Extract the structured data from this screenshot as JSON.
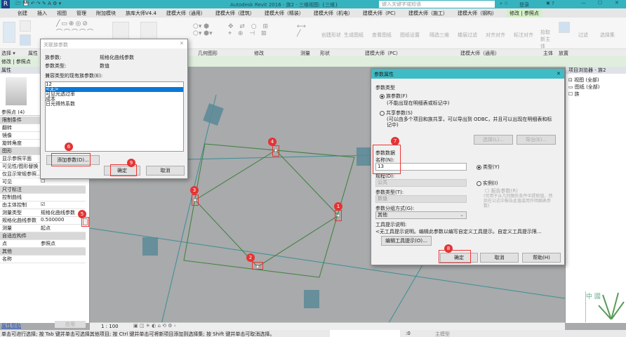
{
  "titlebar": {
    "title": "Autodesk Revit 2016 -  族2 - 三维视图: {三维}",
    "search_placeholder": "键入关键字或短语",
    "login": "登录"
  },
  "tabs": [
    "创建",
    "插入",
    "视图",
    "管理",
    "附加模块",
    "族库大师V4.4",
    "建模大师（通用）",
    "建模大师（建筑）",
    "建模大师（精装）",
    "建模大师（机电）",
    "建模大师（PC）",
    "建模大师（施工）",
    "建模大师（钢构）",
    "修改 | 参照点"
  ],
  "ribbon_panels": [
    "选择 ▾",
    "属性",
    "几何图形",
    "修改",
    "测量",
    "形状",
    "建模大师（PC）",
    "建模大师（通用）",
    "主体",
    "放置"
  ],
  "ribbon_buttons": [
    "创建形状",
    "生成图纸",
    "查看图纸",
    "图纸设置",
    "隔选三维",
    "楼层过滤",
    "对齐对齐",
    "标注对齐",
    "拾取新主体",
    "过滤",
    "选择集"
  ],
  "context_label": "修改 | 参照点",
  "properties": {
    "header": "属性",
    "type_selector": "参照点 (4)",
    "rows": [
      {
        "k": "限制条件",
        "v": "",
        "head": true
      },
      {
        "k": "翻转",
        "v": ""
      },
      {
        "k": "镜像",
        "v": ""
      },
      {
        "k": "旋转角度",
        "v": ""
      },
      {
        "k": "图形",
        "v": "",
        "head": true
      },
      {
        "k": "显示参照平面",
        "v": ""
      },
      {
        "k": "可见性/图形替换",
        "v": ""
      },
      {
        "k": "仅显示常规参照...",
        "v": ""
      },
      {
        "k": "可见",
        "v": "☐"
      },
      {
        "k": "尺寸标注",
        "v": "",
        "head": true
      },
      {
        "k": "控制曲线",
        "v": ""
      },
      {
        "k": "由主体控制",
        "v": "☑"
      },
      {
        "k": "测量类型",
        "v": "规格化曲线参数"
      },
      {
        "k": "规格化曲线参数",
        "v": "0.500000"
      },
      {
        "k": "测量",
        "v": "起点"
      },
      {
        "k": "自适应构件",
        "v": "",
        "head": true
      },
      {
        "k": "点",
        "v": "参照点"
      },
      {
        "k": "其他",
        "v": "",
        "head": true
      },
      {
        "k": "名称",
        "v": ""
      }
    ],
    "help_link": "属性帮助",
    "apply": "应用"
  },
  "dialog_assoc": {
    "title": "关联族参数",
    "family_param_label": "族参数:",
    "family_param_value": "规格化曲线参数",
    "param_type_label": "参数类型:",
    "param_type_value": "数值",
    "list_label": "兼容类型的现有族参数(E):",
    "list": [
      "12",
      "<无>",
      "可见光透过率",
      "成本",
      "日光得热系数"
    ],
    "selected": 1,
    "add_param": "添加参数(D)...",
    "ok": "确定",
    "cancel": "取消"
  },
  "dialog_param": {
    "title": "参数属性",
    "section_type": "参数类型",
    "family_param": "族参数(F)",
    "family_param_note": "(不能出现在明细表或标记中)",
    "shared_param": "共享参数(S)",
    "shared_param_note": "(可以由多个项目和族共享，可以导出到 ODBC，并且可以出现在明细表和标记中)",
    "select_btn": "选择(L)...",
    "export_btn": "导出(E)...",
    "section_data": "参数数据",
    "name_label": "名称(N):",
    "name_value": "13",
    "type_radio": "类型(Y)",
    "instance_radio": "实例(I)",
    "discipline_label": "规程(D):",
    "discipline_value": "公共",
    "ptype_label": "参数类型(T):",
    "ptype_value": "数值",
    "group_label": "参数分组方式(G):",
    "group_value": "其他",
    "report_param": "报告参数(R)",
    "report_note": "(可用于从几何图形条件中提取值，然后在公式中报告此值或用作明细表参数)",
    "tooltip_label": "工具提示说明:",
    "tooltip_value": "<无工具提示说明。编辑此参数以编写自定义工具提示。自定义工具提示限...",
    "edit_tooltip": "编辑工具提示(O)...",
    "ok": "确定",
    "cancel": "取消",
    "help": "帮助(H)"
  },
  "browser": {
    "title": "项目浏览器 - 族2",
    "items": [
      "视图 (全部)",
      "图纸 (全部)",
      "族"
    ]
  },
  "viewport": {
    "scale": "1 : 100"
  },
  "badges": [
    "1",
    "2",
    "3",
    "4",
    "5",
    "6",
    "7",
    "8",
    "9"
  ],
  "status": {
    "text": "单击可进行选择; 按 Tab 键并单击可选择其他项目; 按 Ctrl 键并单击可将新项目添加到选择集; 按 Shift 键并单击可取消选择。",
    "count": ":0",
    "model": "主模型"
  },
  "watermark": "中 國"
}
